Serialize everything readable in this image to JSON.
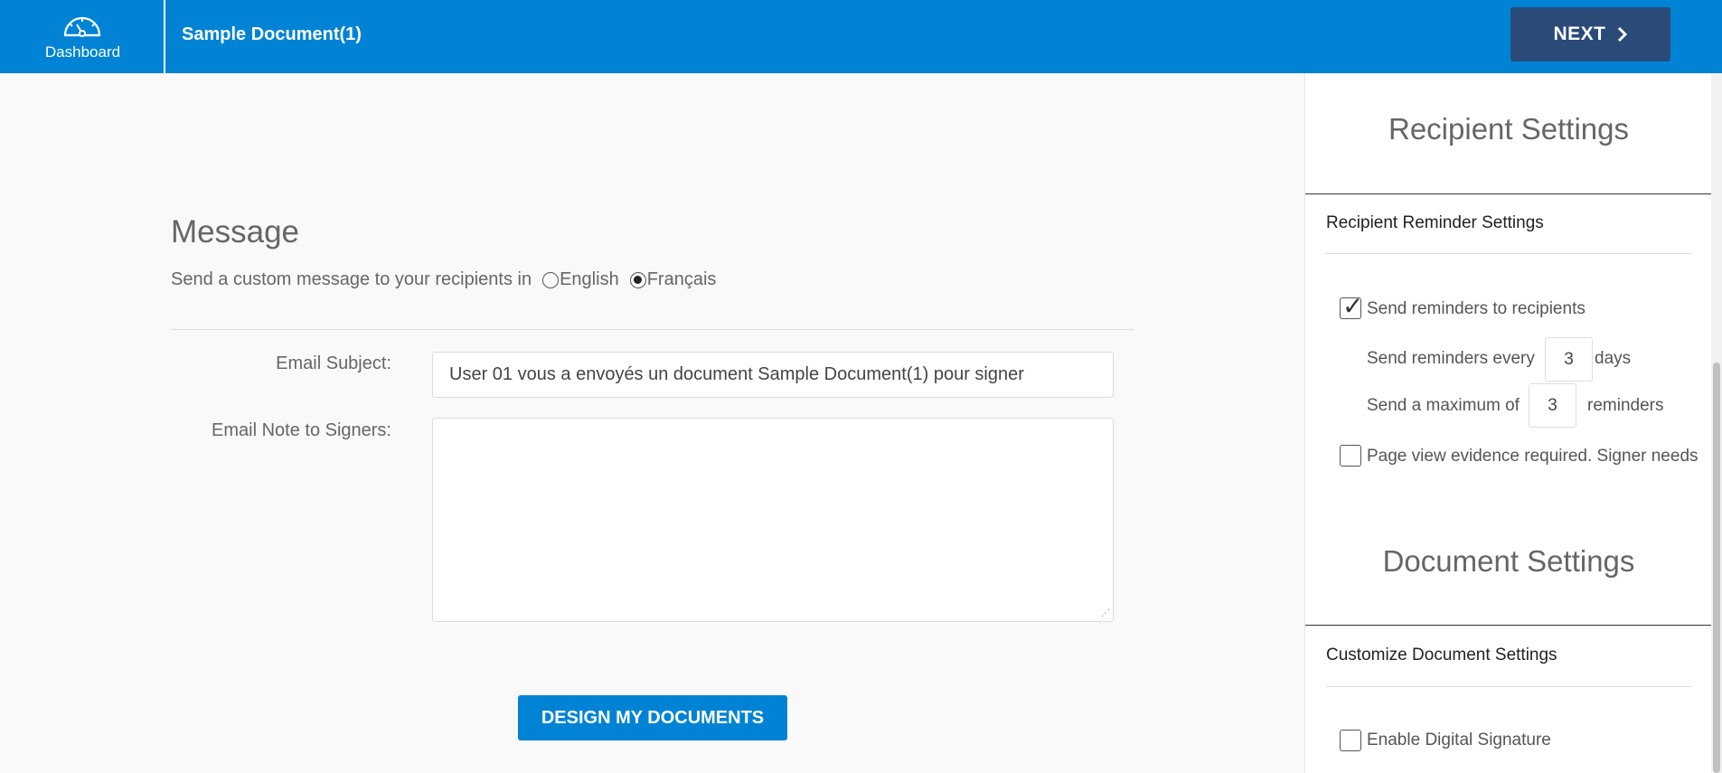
{
  "header": {
    "dashboard_label": "Dashboard",
    "document_title": "Sample Document(1)",
    "next_label": "NEXT",
    "dashboard_icon": "dashboard-gauge-icon",
    "next_icon": "chevron-right-icon"
  },
  "message": {
    "title": "Message",
    "language_prompt": "Send a custom message to your recipients in",
    "languages": [
      {
        "label": "English",
        "selected": false
      },
      {
        "label": "Français",
        "selected": true
      }
    ],
    "email_subject_label": "Email Subject:",
    "email_subject_value": "User 01 vous a envoyés un document Sample Document(1) pour signer",
    "email_note_label": "Email Note to Signers:",
    "email_note_value": "",
    "design_button_label": "DESIGN MY DOCUMENTS"
  },
  "recipient_settings": {
    "heading": "Recipient Settings",
    "reminder_section_title": "Recipient Reminder Settings",
    "send_reminders_label": "Send reminders to recipients",
    "send_reminders_checked": true,
    "every_prefix": "Send reminders every",
    "every_value": "3",
    "every_suffix": "days",
    "max_prefix": "Send a maximum of",
    "max_value": "3",
    "max_suffix": "reminders",
    "page_view_label": "Page view evidence required. Signer needs",
    "page_view_checked": false
  },
  "document_settings": {
    "heading": "Document Settings",
    "section_title": "Customize Document Settings",
    "digital_signature_label": "Enable Digital Signature",
    "digital_signature_checked": false
  },
  "colors": {
    "header_blue": "#0083d5",
    "next_button": "#2a4a78"
  }
}
